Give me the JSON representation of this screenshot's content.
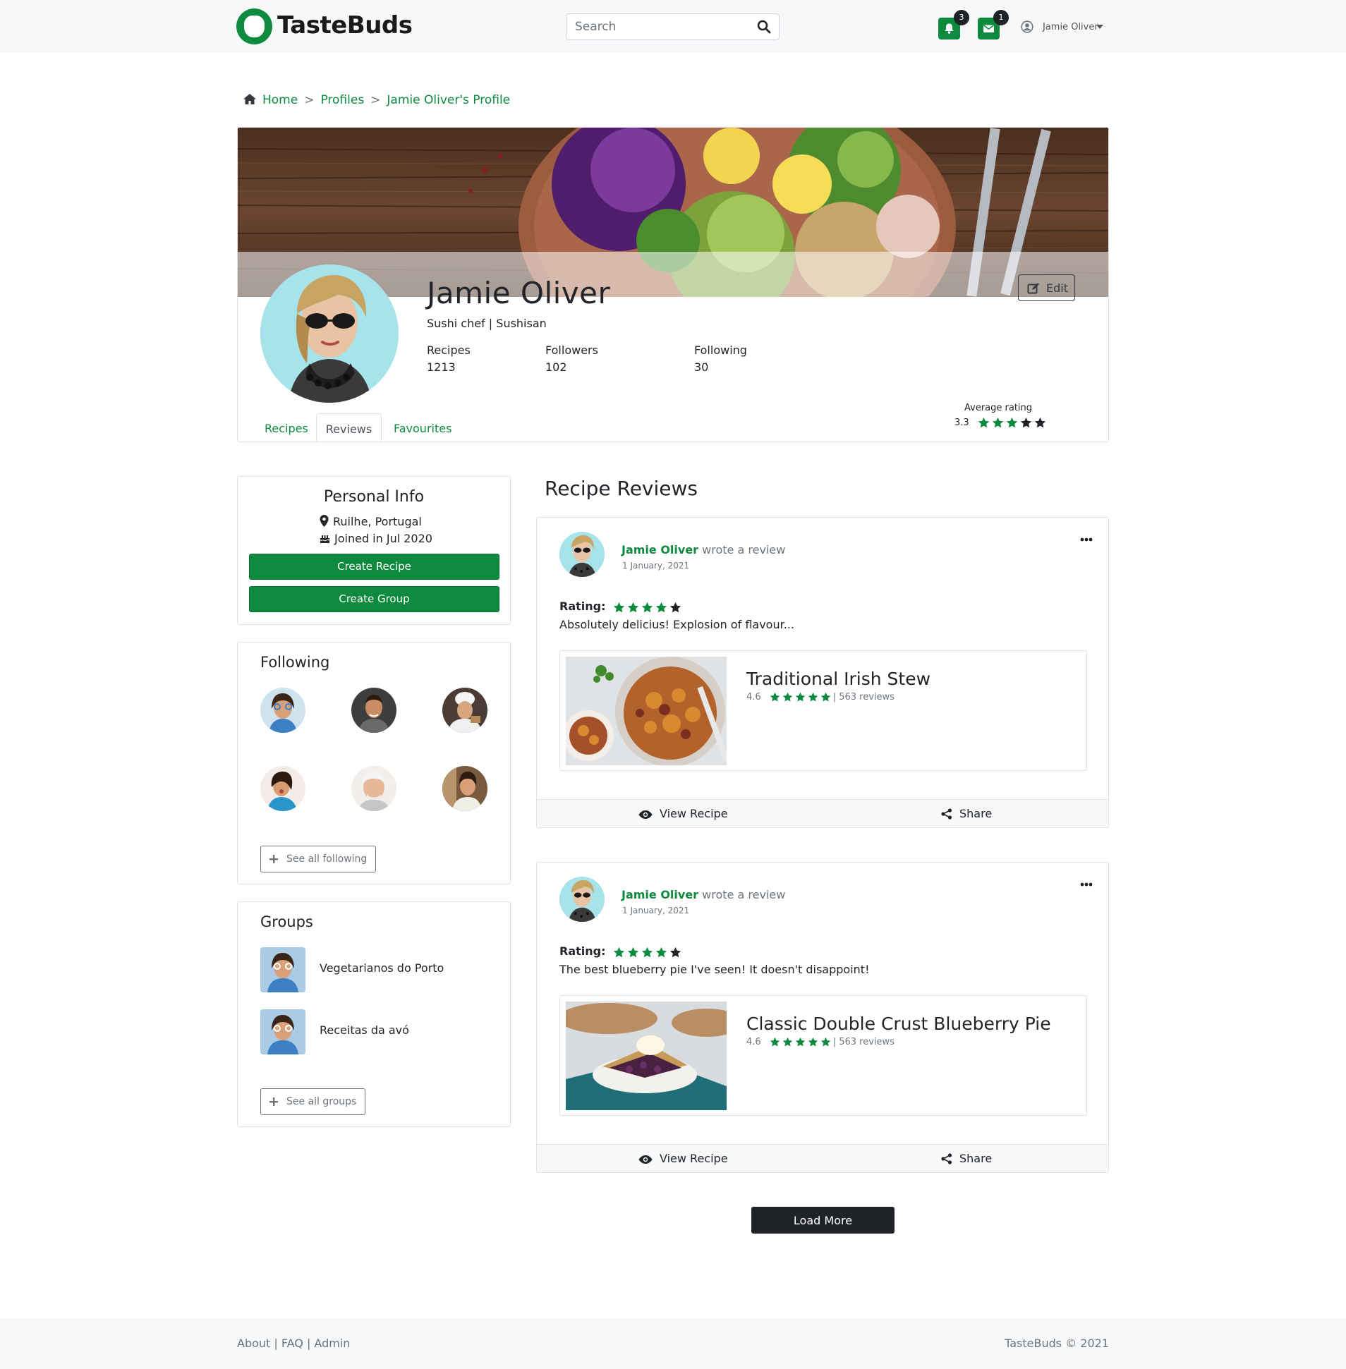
{
  "brand": {
    "name": "TasteBuds",
    "accent": "#0e8a3f",
    "dark": "#1f2226"
  },
  "navbar": {
    "search_placeholder": "Search",
    "notifications_count": "3",
    "messages_count": "1",
    "user_name": "Jamie Oliver"
  },
  "breadcrumb": {
    "home": "Home",
    "sep": ">",
    "profiles": "Profiles",
    "current": "Jamie Oliver's Profile"
  },
  "profile": {
    "name": "Jamie Oliver",
    "subtitle": "Sushi chef | Sushisan",
    "edit_label": "Edit",
    "stats": [
      {
        "label": "Recipes",
        "value": "1213"
      },
      {
        "label": "Followers",
        "value": "102"
      },
      {
        "label": "Following",
        "value": "30"
      }
    ],
    "avg_rating_label": "Average rating",
    "avg_rating_value": "3.3",
    "avg_rating_stars": 3,
    "tabs": [
      "Recipes",
      "Reviews",
      "Favourites"
    ],
    "active_tab": "Reviews"
  },
  "personal_info": {
    "title": "Personal Info",
    "location": "Ruilhe, Portugal",
    "joined": "Joined in Jul 2020",
    "create_recipe": "Create Recipe",
    "create_group": "Create Group"
  },
  "following": {
    "title": "Following",
    "see_all": "See all following"
  },
  "groups": {
    "title": "Groups",
    "items": [
      "Vegetarianos do Porto",
      "Receitas da avó"
    ],
    "see_all": "See all groups"
  },
  "reviews_section": {
    "title": "Recipe Reviews",
    "rating_label": "Rating:",
    "wrote": "wrote a review",
    "view_label": "View Recipe",
    "share_label": "Share",
    "items": [
      {
        "author": "Jamie Oliver",
        "date": "1 January, 2021",
        "stars": 4,
        "text": "Absolutely delicius! Explosion of flavour...",
        "recipe_title": "Traditional Irish Stew",
        "recipe_rating": "4.6",
        "recipe_stars": 5,
        "recipe_reviews": "| 563 reviews"
      },
      {
        "author": "Jamie Oliver",
        "date": "1 January, 2021",
        "stars": 4,
        "text": "The best blueberry pie I've seen! It doesn't disappoint!",
        "recipe_title": "Classic Double Crust Blueberry Pie",
        "recipe_rating": "4.6",
        "recipe_stars": 5,
        "recipe_reviews": "| 563 reviews"
      }
    ],
    "load_more": "Load More"
  },
  "footer": {
    "links": "About | FAQ | Admin",
    "copyright": "TasteBuds © 2021"
  }
}
